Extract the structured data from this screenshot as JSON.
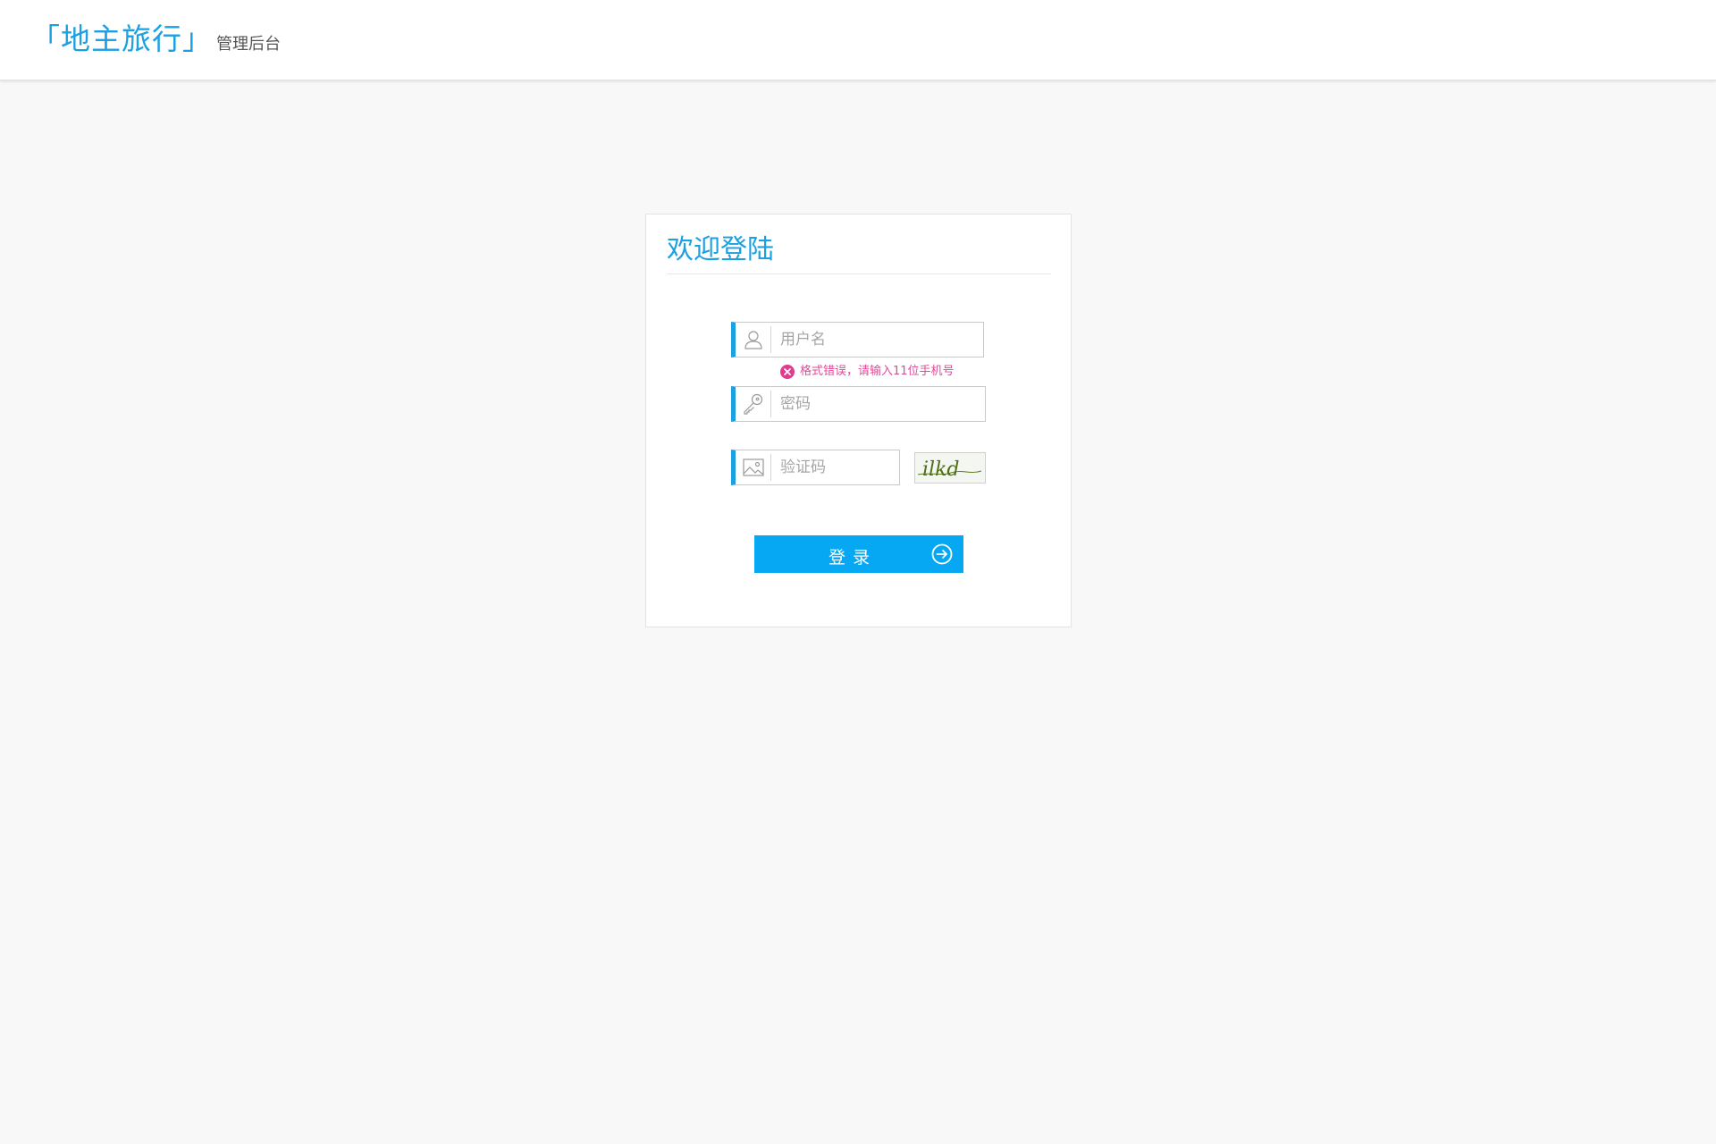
{
  "header": {
    "brand_name": "「地主旅行」",
    "brand_sub": "管理后台"
  },
  "login": {
    "title": "欢迎登陆",
    "username_placeholder": "用户名",
    "username_error": "格式错误，请输入11位手机号",
    "password_placeholder": "密码",
    "captcha_placeholder": "验证码",
    "captcha_text": "ilkd",
    "submit_label": "登录"
  },
  "icons": {
    "username": "user-icon",
    "password": "key-icon",
    "captcha": "image-icon",
    "error": "error-x-icon",
    "submit": "arrow-right-circle-icon"
  },
  "colors": {
    "accent": "#1ba0e2",
    "button": "#06a8f3",
    "error": "#e24a9a",
    "background": "#f8f8f8"
  }
}
